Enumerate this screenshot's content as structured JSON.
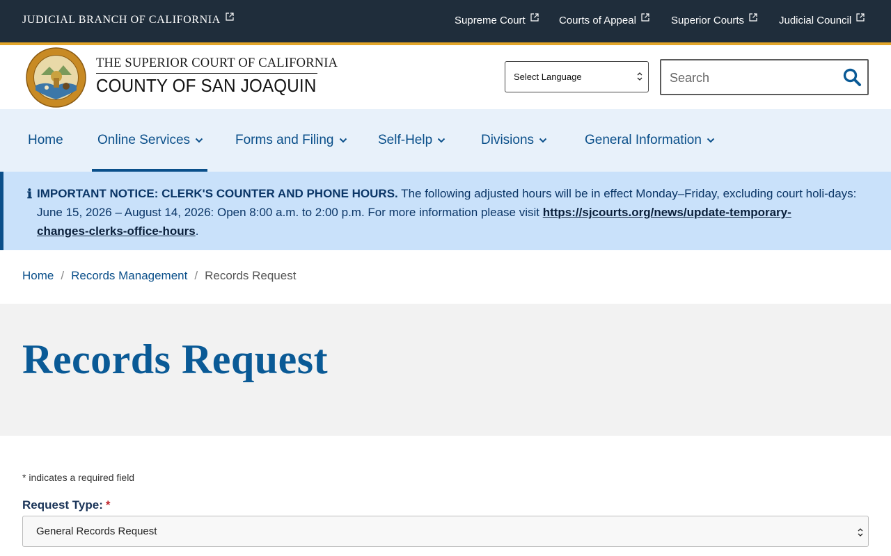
{
  "topbar": {
    "branch_title": "JUDICIAL BRANCH OF CALIFORNIA",
    "links": [
      "Supreme Court",
      "Courts of Appeal",
      "Superior Courts",
      "Judicial Council"
    ]
  },
  "header": {
    "court_line1": "THE SUPERIOR COURT OF CALIFORNIA",
    "court_line2": "COUNTY OF SAN JOAQUIN",
    "language_select": "Select Language",
    "search_placeholder": "Search"
  },
  "nav": {
    "items": [
      "Home",
      "Online Services",
      "Forms and Filing",
      "Self-Help",
      "Divisions",
      "General Information"
    ],
    "active": "Online Services"
  },
  "notice": {
    "heading": "IMPORTANT NOTICE: CLERK'S COUNTER AND PHONE HOURS.",
    "body": " The following adjusted hours will be in effect Monday–Friday, excluding court holi-days: June 15, 2026 – August 14, 2026: Open 8:00 a.m. to 2:00 p.m. For more information please visit ",
    "link": "https://sjcourts.org/news/update-temporary-changes-clerks-office-hours",
    "link_line1": "https://sjcourts.org/news/update-temporary-",
    "link_line2": "changes-clerks-office-hours",
    "tail": "."
  },
  "breadcrumb": {
    "items": [
      "Home",
      "Records Management"
    ],
    "current": "Records Request",
    "separator": "/"
  },
  "page": {
    "title": "Records Request"
  },
  "form": {
    "required_note": "* indicates a required field",
    "request_type_label": "Request Type:",
    "required_star": "*",
    "request_type_value": "General Records Request"
  },
  "colors": {
    "topbar": "#1f2d3b",
    "gold": "#e3a62a",
    "link_blue": "#0a4f8a",
    "nav_bg": "#e8f1fa",
    "notice_bg": "#c9e1fa",
    "title_band": "#f2f2f2"
  }
}
